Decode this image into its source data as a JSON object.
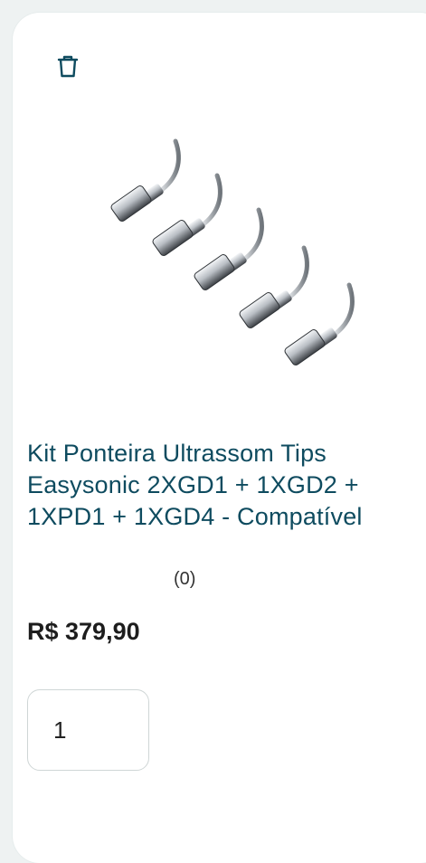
{
  "product": {
    "title": "Kit Ponteira Ultrassom Tips Easysonic 2XGD1 + 1XGD2 + 1XPD1 + 1XGD4 - Compatível",
    "rating_count": "(0)",
    "price": "R$ 379,90",
    "image_icon": "ultrasonic-scaler-tips-image"
  },
  "actions": {
    "remove_icon": "trash-icon"
  },
  "quantity": {
    "value": "1"
  },
  "colors": {
    "title": "#0e4b5f",
    "icon": "#0e4b5f",
    "price": "#1d1d1d",
    "metal_light": "#e9ecef",
    "metal_dark": "#3b3f44"
  }
}
